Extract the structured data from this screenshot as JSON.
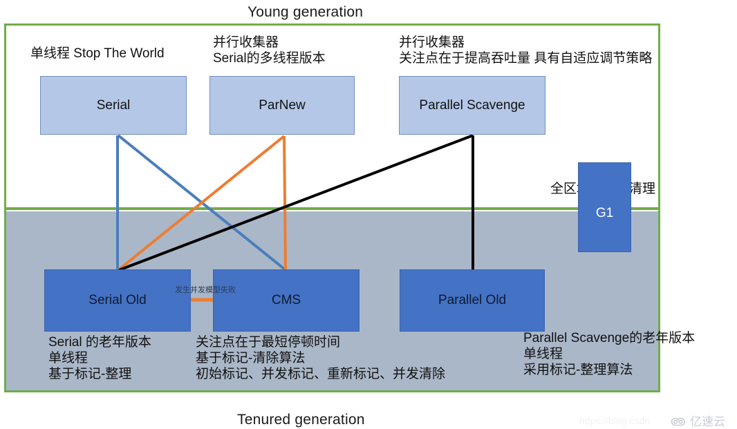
{
  "diagram": {
    "young_generation_title": "Young generation",
    "tenured_generation_title": "Tenured generation"
  },
  "colors": {
    "frame_green": "#70ad47",
    "young_box_fill": "#b4c7e7",
    "old_box_fill": "#4472c4",
    "tenured_fill": "#aab7c8",
    "connector_blue": "#4a7ebb",
    "connector_orange": "#ed7d31",
    "connector_black": "#000000"
  },
  "young_nodes": [
    {
      "id": "serial",
      "label": "Serial",
      "annotation": "单线程 Stop The World"
    },
    {
      "id": "parnew",
      "label": "ParNew",
      "annotation": "并行收集器\nSerial的多线程版本"
    },
    {
      "id": "parallel-scavenge",
      "label": "Parallel Scavenge",
      "annotation": "并行收集器\n关注点在于提高吞吐量 具有自适应调节策略"
    }
  ],
  "old_nodes": [
    {
      "id": "serial-old",
      "label": "Serial  Old",
      "annotation": "Serial 的老年版本\n单线程\n基于标记-整理"
    },
    {
      "id": "cms",
      "label": "CMS",
      "annotation": "关注点在于最短停顿时间\n基于标记-清除算法\n初始标记、并发标记、重新标记、并发清除"
    },
    {
      "id": "parallel-old",
      "label": "Parallel Old",
      "annotation": "Parallel Scavenge的老年版本\n单线程\n采用标记-整理算法"
    }
  ],
  "g1_node": {
    "id": "g1",
    "label": "G1",
    "annotation": "全区域的垃圾清理"
  },
  "edge_label": {
    "text": "发生并发模型失败"
  },
  "watermark": {
    "url": "https://blog.csdn",
    "brand": "亿速云",
    "logo_icon": "cloud-icon"
  }
}
